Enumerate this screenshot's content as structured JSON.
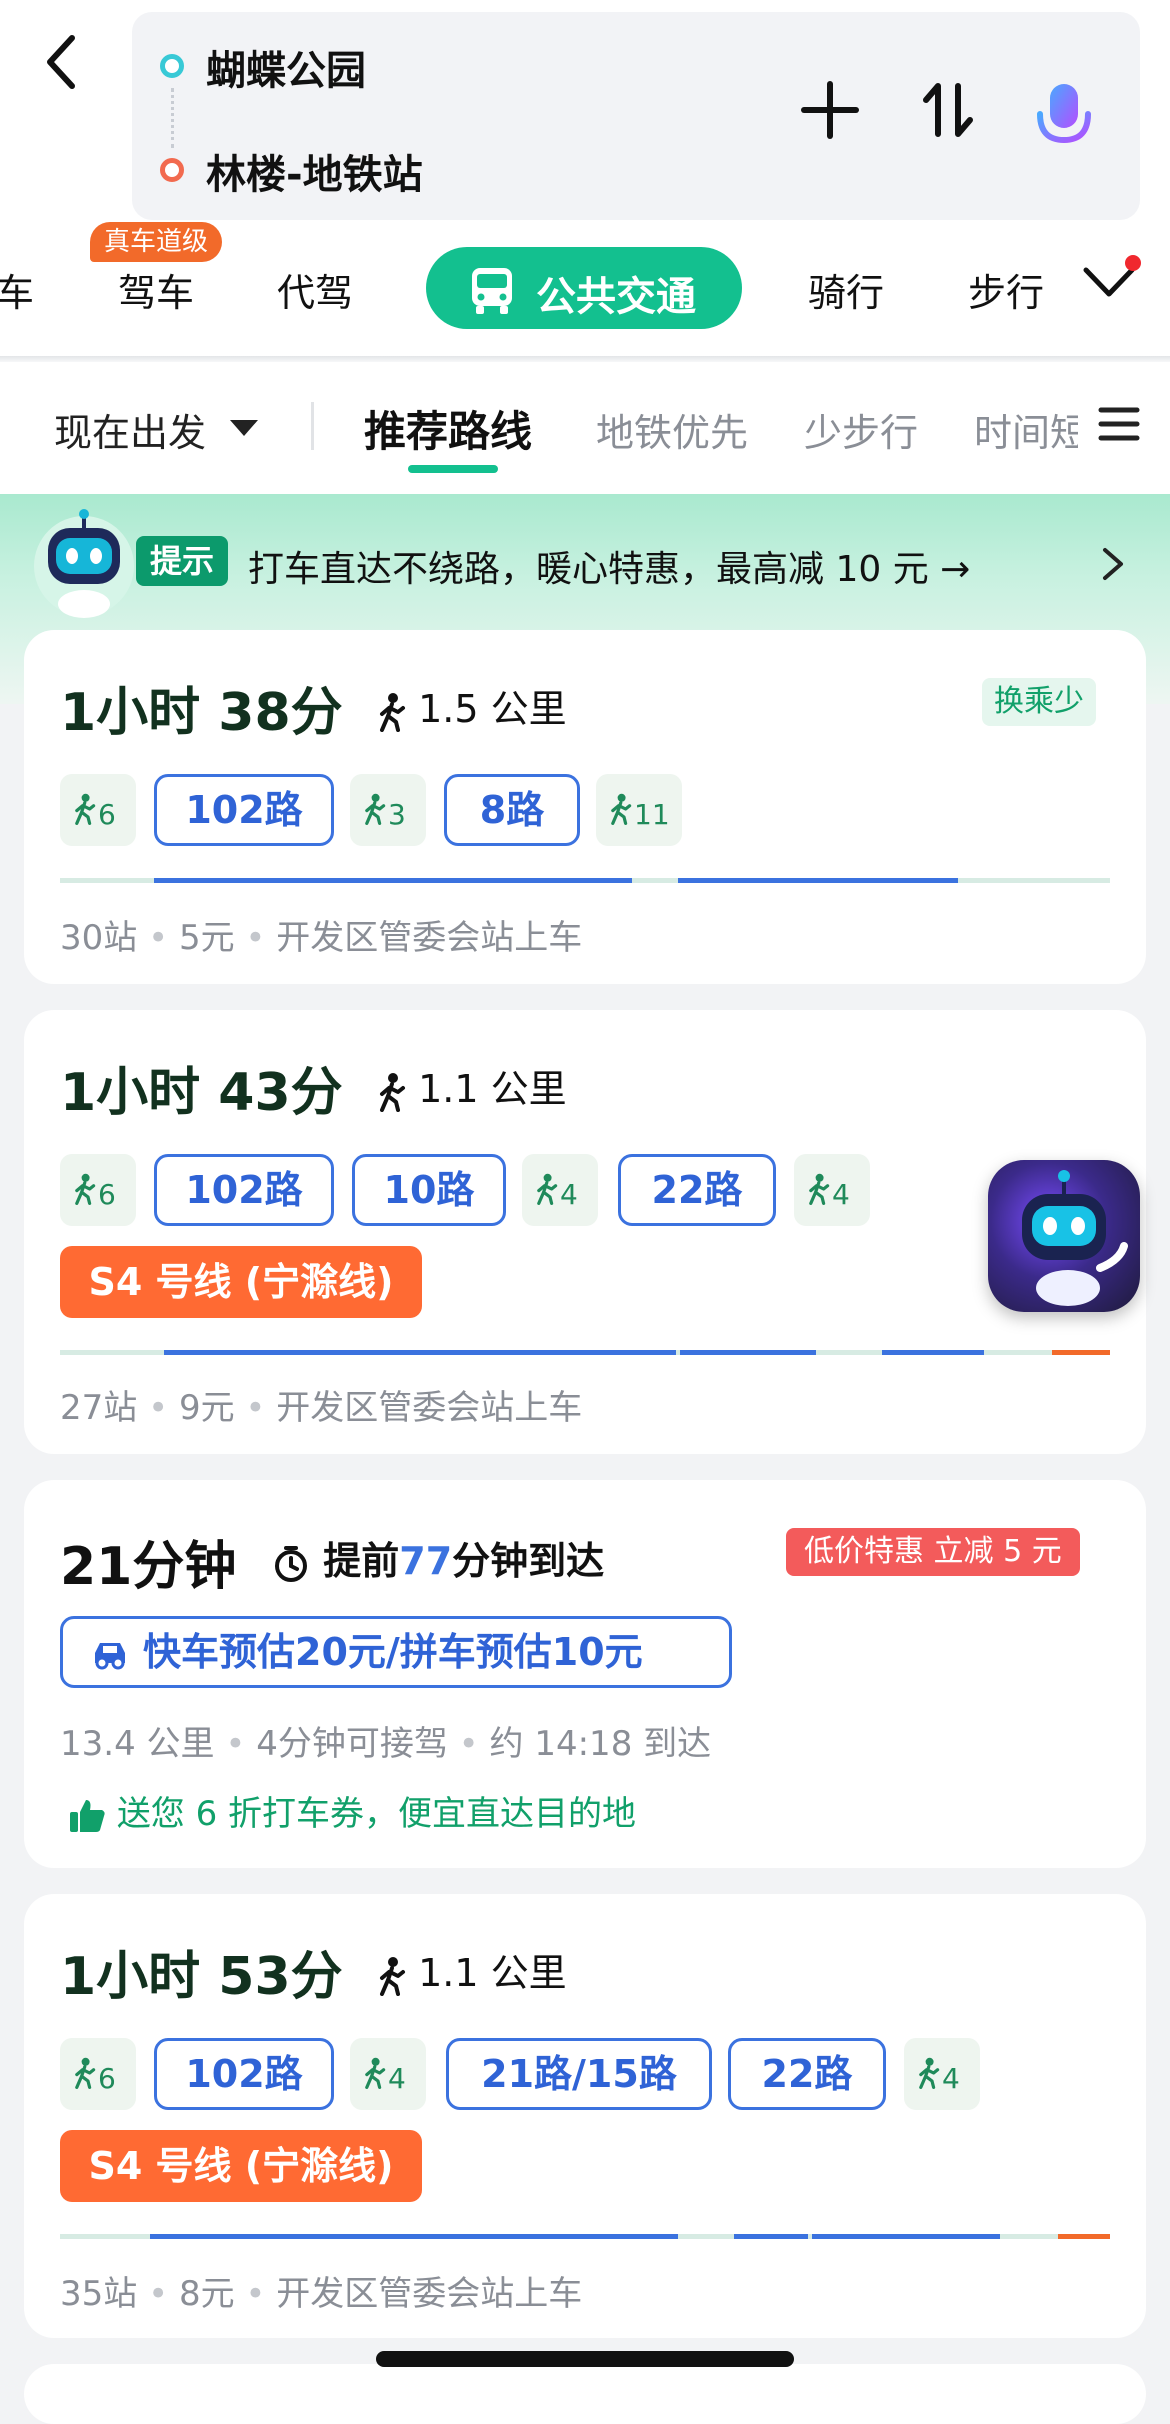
{
  "search": {
    "origin": "蝴蝶公园",
    "destination": "林楼-地铁站"
  },
  "modes": {
    "taxi": "车",
    "drive": "驾车",
    "drive_badge": "真车道级",
    "chauffeur": "代驾",
    "transit": "公共交通",
    "bike": "骑行",
    "walk": "步行"
  },
  "filters": {
    "depart": "现在出发",
    "recommend": "推荐路线",
    "subway_first": "地铁优先",
    "less_walking": "少步行",
    "time_short": "时间短"
  },
  "tip": {
    "tag": "提示",
    "text": "打车直达不绕路，暖心特惠，最高减 10 元 →"
  },
  "routes": [
    {
      "duration": "1小时 38分",
      "walk_distance": "1.5 公里",
      "badge": "换乘少",
      "walks": [
        "6",
        "3",
        "11"
      ],
      "lines": [
        "102路",
        "8路"
      ],
      "stops": "30站",
      "fare": "5元",
      "board": "开发区管委会站上车"
    },
    {
      "duration": "1小时 43分",
      "walk_distance": "1.1 公里",
      "walks": [
        "6",
        "4",
        "4"
      ],
      "lines": [
        "102路",
        "10路",
        "22路",
        "S4 号线 (宁滁线)"
      ],
      "stops": "27站",
      "fare": "9元",
      "board": "开发区管委会站上车"
    },
    {
      "duration": "21分钟",
      "early_prefix": "提前",
      "early_minutes": "77",
      "early_suffix": "分钟到达",
      "badge": "低价特惠 立减 5 元",
      "taxi_estimate": "快车预估20元/拼车预估10元",
      "distance": "13.4 公里",
      "pickup": "4分钟可接驾",
      "arrival": "约 14:18 到达",
      "promo": "送您 6 折打车券，便宜直达目的地"
    },
    {
      "duration": "1小时 53分",
      "walk_distance": "1.1 公里",
      "walks": [
        "6",
        "4",
        "4"
      ],
      "lines": [
        "102路",
        "21路/15路",
        "22路",
        "S4 号线 (宁滁线)"
      ],
      "stops": "35站",
      "fare": "8元",
      "board": "开发区管委会站上车"
    }
  ],
  "colors": {
    "accent": "#13c08f",
    "bus_line": "#3b72df",
    "metro": "#ff6a33",
    "promo_red": "#f35b5b"
  },
  "icons": [
    "back-icon",
    "plus-icon",
    "swap-icon",
    "mic-icon",
    "bus-icon",
    "chevron-down-icon",
    "menu-icon",
    "walk-icon",
    "clock-icon",
    "taxi-icon",
    "thumbs-up-icon",
    "chevron-right-icon",
    "assistant-robot-icon"
  ]
}
